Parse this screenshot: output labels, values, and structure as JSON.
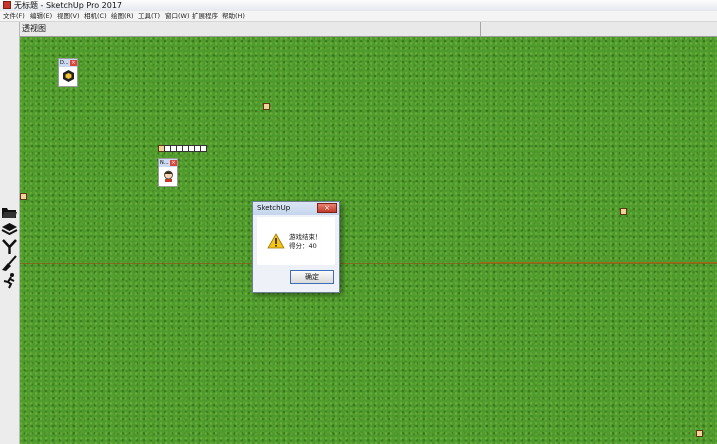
{
  "window": {
    "title": "无标题 - SketchUp Pro 2017"
  },
  "menu": {
    "items": [
      "文件(F)",
      "编辑(E)",
      "视图(V)",
      "相机(C)",
      "绘图(R)",
      "工具(T)",
      "窗口(W)",
      "扩展程序",
      "帮助(H)"
    ]
  },
  "toolbar": {
    "icons": [
      "open-folder-icon",
      "layers-icon",
      "slingshot-icon",
      "brush-icon",
      "running-man-icon"
    ]
  },
  "viewport": {
    "label": "透视图"
  },
  "mini_windows": [
    {
      "title": "D...",
      "close": "×"
    },
    {
      "title": "N...",
      "close": "×"
    }
  ],
  "dialog": {
    "title": "SketchUp",
    "close_label": "×",
    "message_line1": "游戏结束！",
    "message_line2": "得分：40",
    "ok_label": "确定"
  },
  "colors": {
    "grass": "#4f9a2c",
    "food": "#f2d19c",
    "dialog_close": "#c2392b",
    "ok_border": "#3b6fb6"
  }
}
